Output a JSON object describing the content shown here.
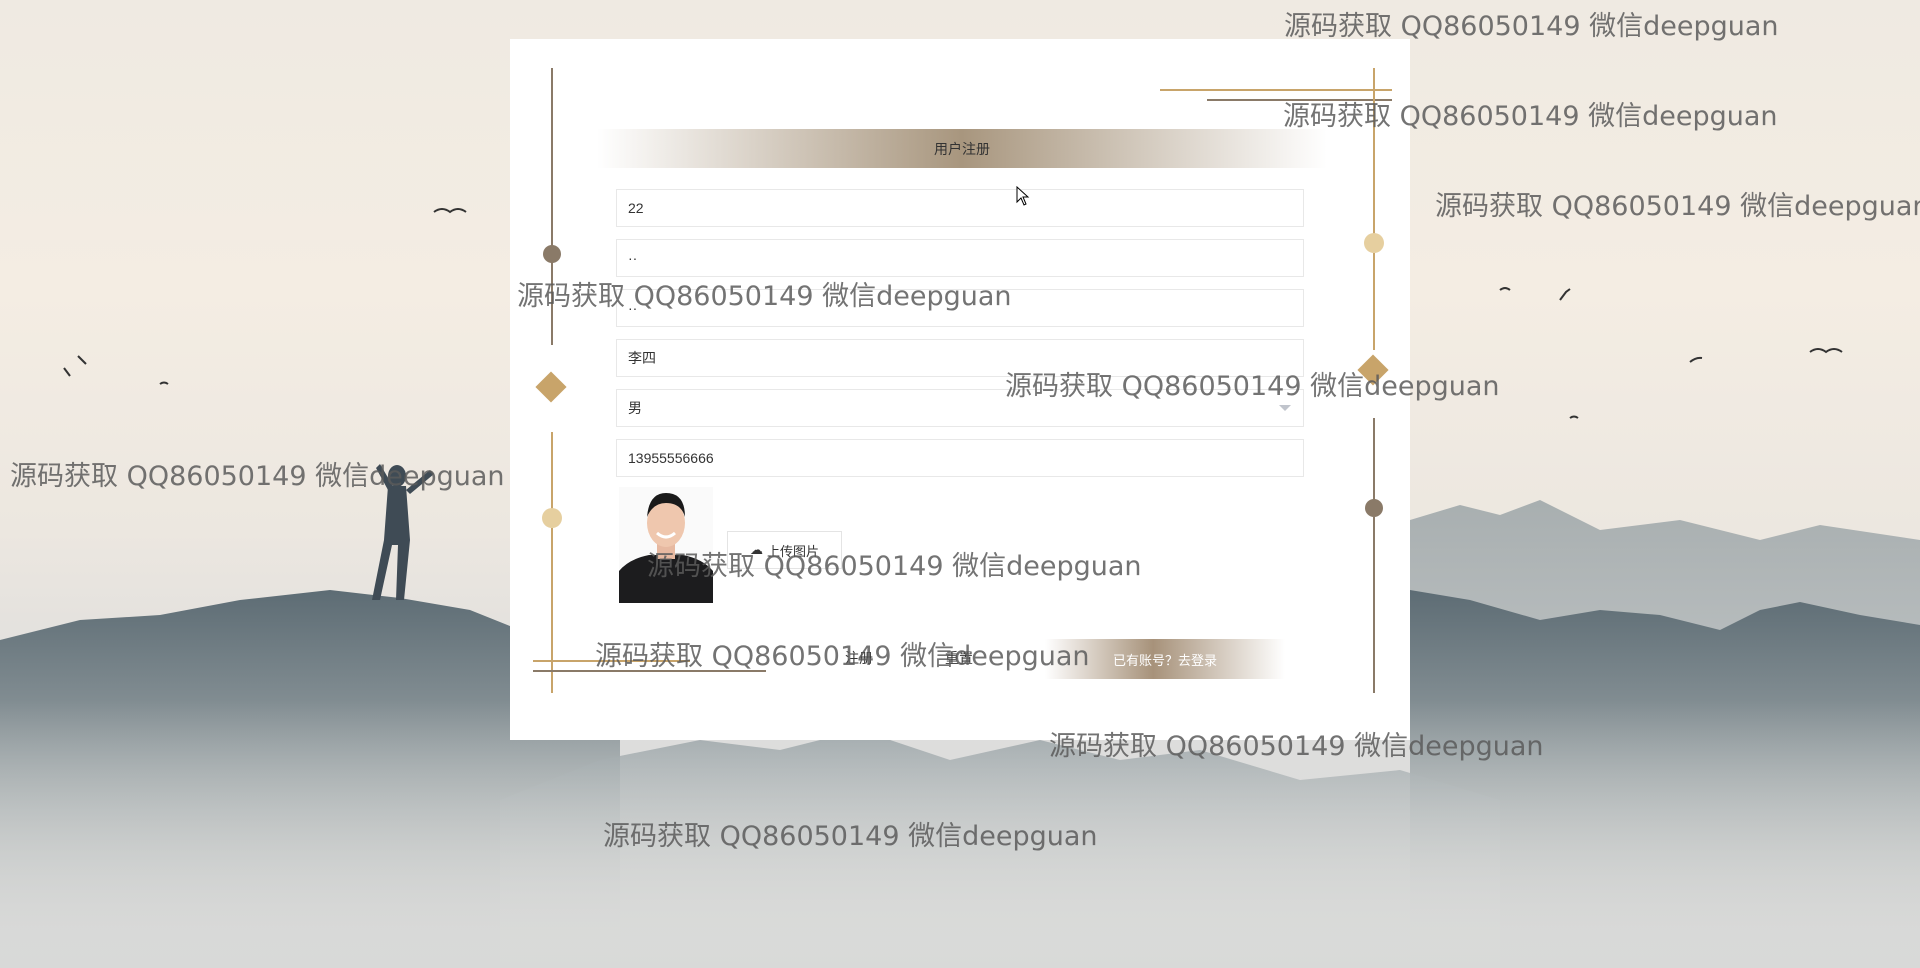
{
  "form": {
    "title": "用户注册",
    "username_value": "22",
    "password_value": "··",
    "confirm_password_value": "··",
    "name_value": "李四",
    "gender_value": "男",
    "phone_value": "13955556666",
    "upload_label": "上传图片",
    "register_label": "注册",
    "reset_label": "重置",
    "login_link_label": "已有账号？去登录"
  },
  "watermark": {
    "text": "源码获取 QQ86050149 微信deepguan"
  },
  "colors": {
    "accent_gold": "#c8a46a",
    "accent_brown": "#8a7a68",
    "title_bar": "#a8967e"
  }
}
